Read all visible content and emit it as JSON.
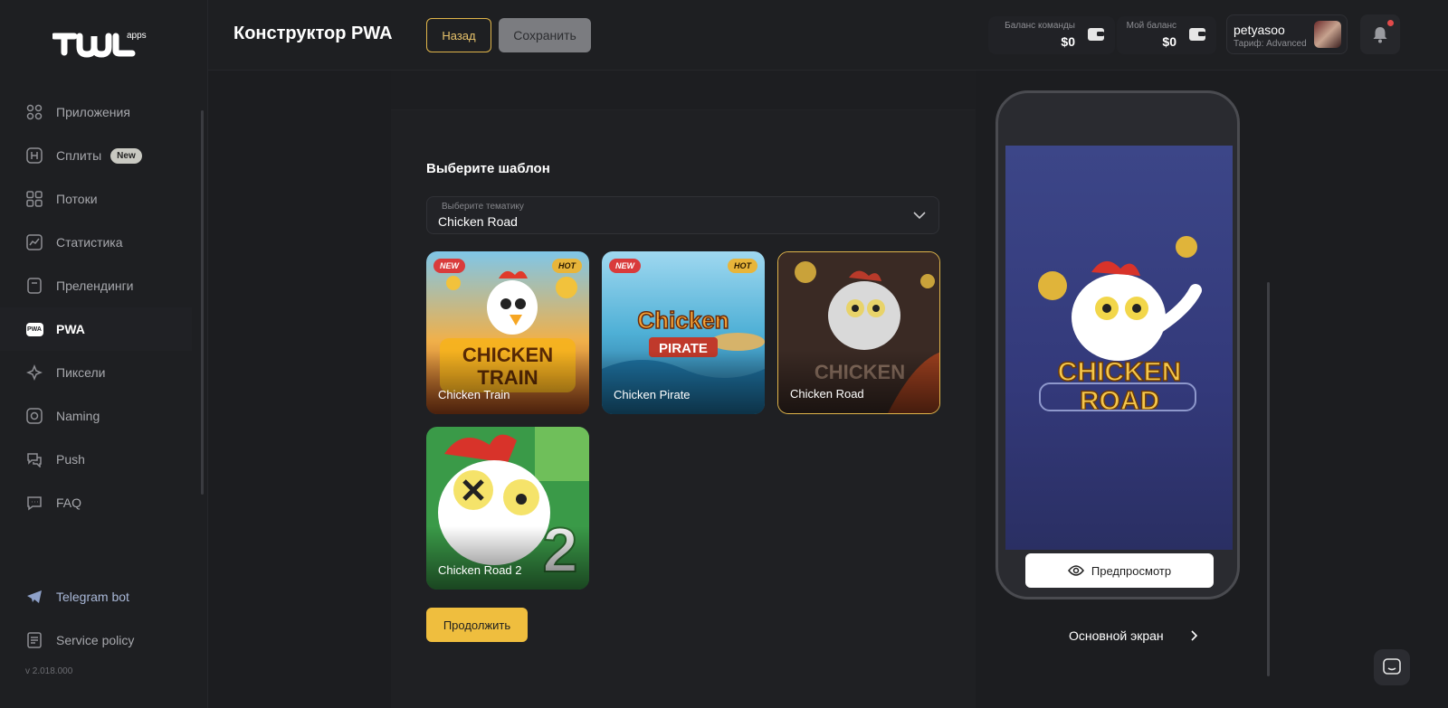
{
  "app": {
    "logo_text": "apps",
    "version": "v 2.018.000"
  },
  "sidebar": {
    "items": [
      {
        "label": "Приложения",
        "icon": "grid-icon"
      },
      {
        "label": "Сплиты",
        "icon": "split-icon",
        "badge": "New"
      },
      {
        "label": "Потоки",
        "icon": "flows-icon"
      },
      {
        "label": "Статистика",
        "icon": "chart-icon"
      },
      {
        "label": "Прелендинги",
        "icon": "prelanding-icon"
      },
      {
        "label": "PWA",
        "icon": "pwa-icon",
        "active": true
      },
      {
        "label": "Пиксели",
        "icon": "pixel-icon"
      },
      {
        "label": "Naming",
        "icon": "naming-icon"
      },
      {
        "label": "Push",
        "icon": "push-icon"
      },
      {
        "label": "FAQ",
        "icon": "faq-icon"
      }
    ],
    "bottom": [
      {
        "label": "Telegram bot",
        "icon": "telegram-icon"
      },
      {
        "label": "Service policy",
        "icon": "document-icon"
      }
    ]
  },
  "header": {
    "title": "Конструктор PWA",
    "back_label": "Назад",
    "save_label": "Сохранить",
    "team_balance_label": "Баланс команды",
    "team_balance_value": "$0",
    "my_balance_label": "Мой баланс",
    "my_balance_value": "$0",
    "username": "petyasoo",
    "plan": "Тариф: Advanced"
  },
  "main": {
    "section_title": "Выберите шаблон",
    "theme_select_label": "Выберите тематику",
    "theme_select_value": "Chicken Road",
    "templates": [
      {
        "name": "Chicken Train",
        "new": "NEW",
        "hot": "HOT",
        "art_text": "CHICKEN TRAIN"
      },
      {
        "name": "Chicken Pirate",
        "new": "NEW",
        "hot": "HOT",
        "art_text": "Chicken PIRATE"
      },
      {
        "name": "Chicken Road",
        "selected": true,
        "art_text": "CHICKEN ROAD"
      },
      {
        "name": "Chicken Road 2",
        "art_text": "2"
      }
    ],
    "continue_label": "Продолжить"
  },
  "preview": {
    "logo_text_1": "CHICKEN",
    "logo_text_2": "ROAD",
    "preview_label": "Предпросмотр",
    "screen_label": "Основной экран"
  },
  "colors": {
    "accent": "#efbe3e",
    "background": "#1c1d20",
    "badge_new": "#d93b3b",
    "badge_hot": "#e8b53a"
  }
}
